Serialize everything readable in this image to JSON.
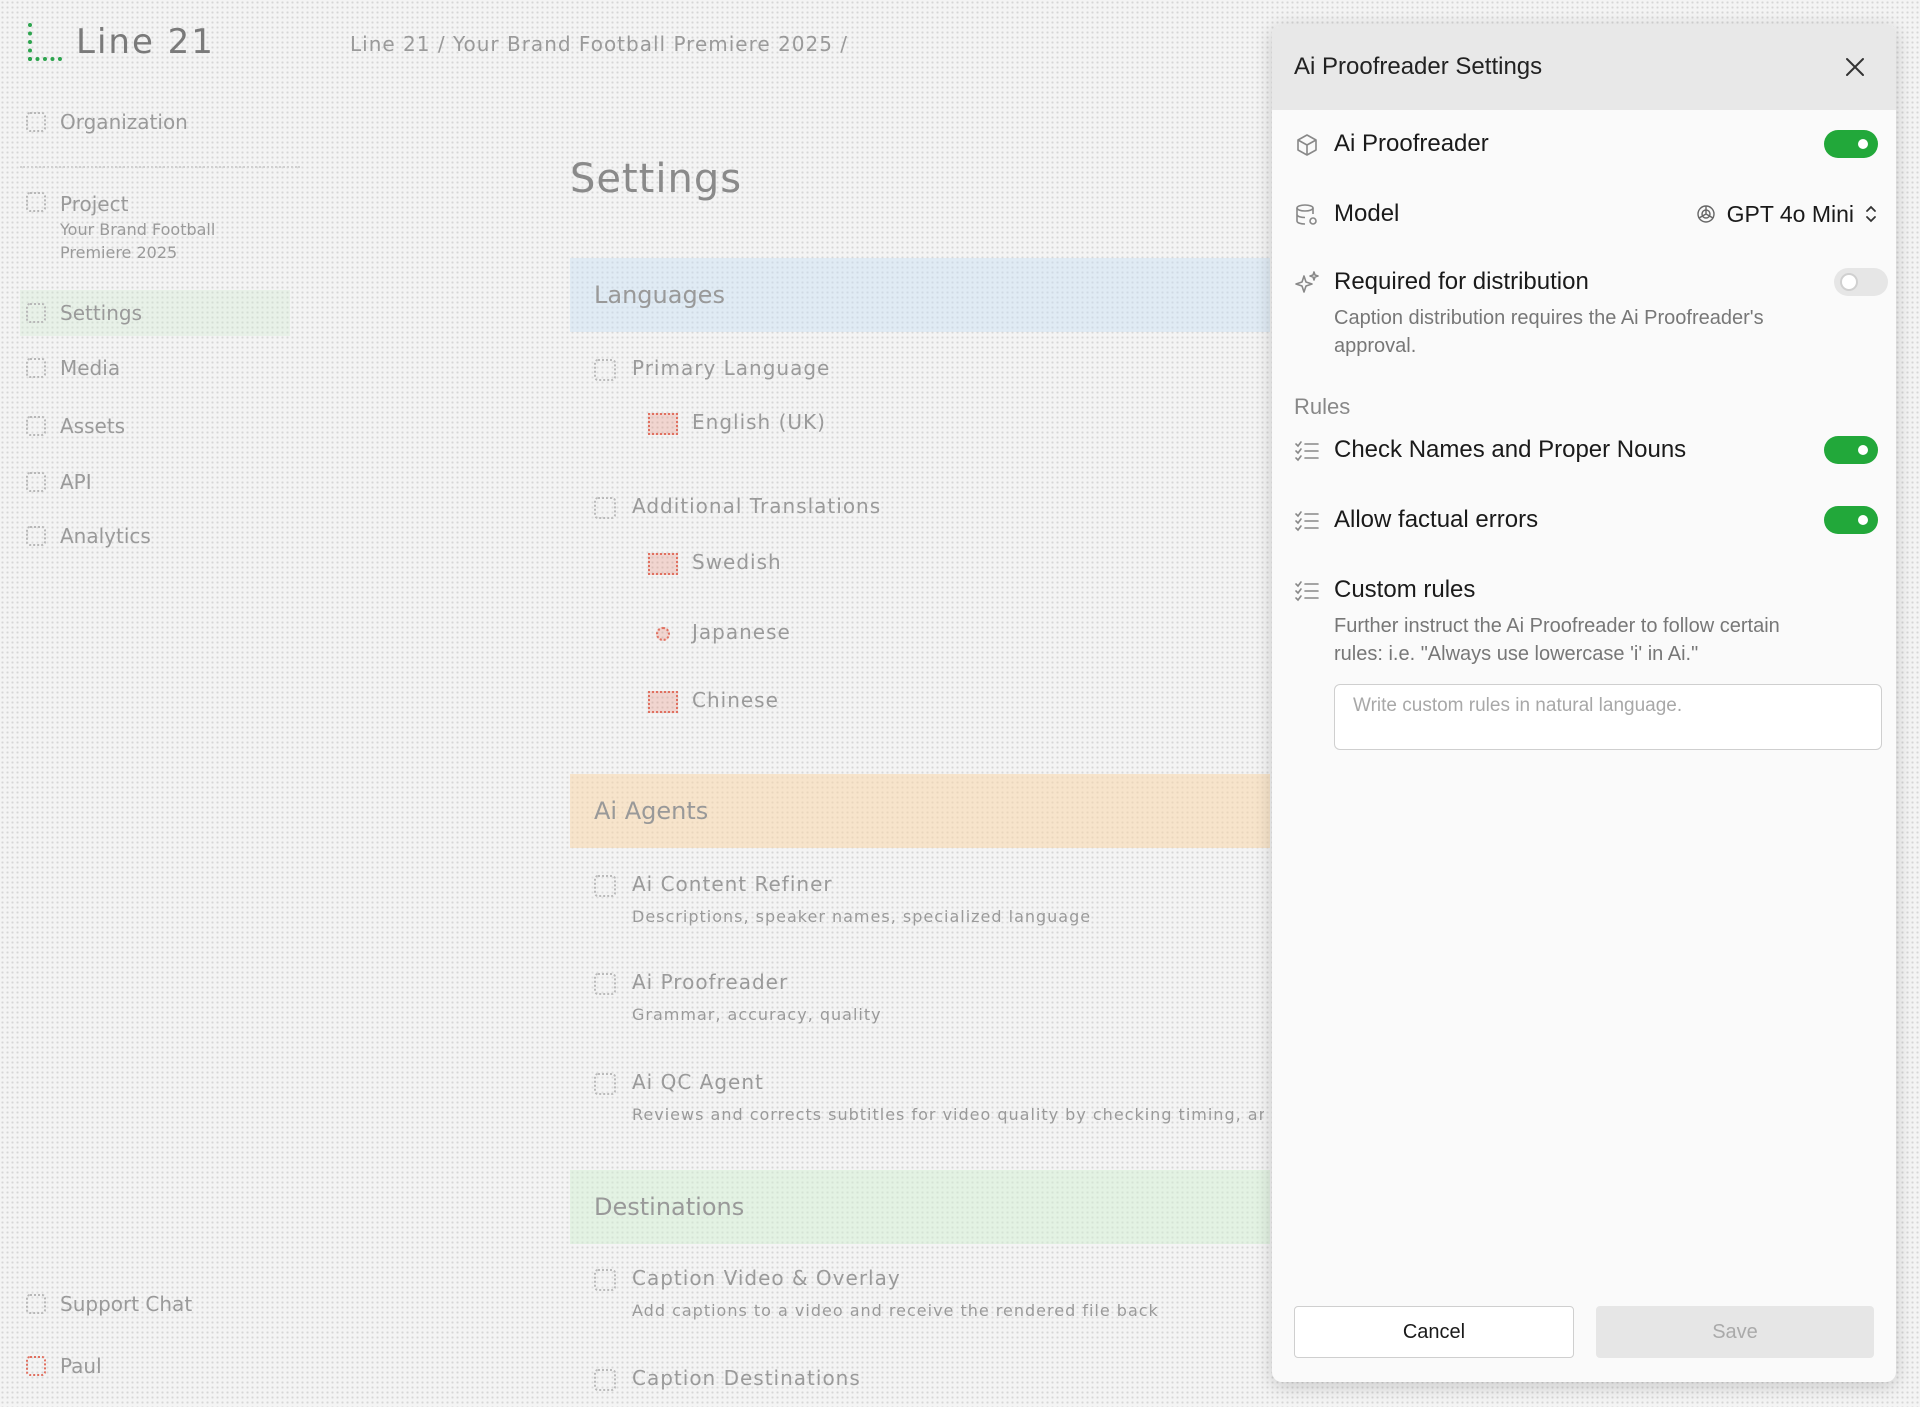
{
  "background": {
    "logo_text": "Line 21",
    "breadcrumb": "Line 21  /  Your Brand Football Premiere 2025  /",
    "sidebar": {
      "organization": "Organization",
      "project_label": "Project",
      "project_line1": "Your Brand Football",
      "project_line2": "Premiere 2025",
      "items": [
        {
          "label": "Settings"
        },
        {
          "label": "Media"
        },
        {
          "label": "Assets"
        },
        {
          "label": "API"
        },
        {
          "label": "Analytics"
        }
      ],
      "support": "Support Chat",
      "user": "Paul"
    },
    "page_title": "Settings",
    "sections": {
      "languages": "Languages",
      "primary_language": "Primary Language",
      "primary_value": "English (UK)",
      "additional_translations": "Additional Translations",
      "translations": [
        "Swedish",
        "Japanese",
        "Chinese"
      ],
      "ai_agents": "Ai Agents",
      "agents": [
        {
          "name": "Ai Content Refiner",
          "desc": "Descriptions, speaker names, specialized language"
        },
        {
          "name": "Ai Proofreader",
          "desc": "Grammar, accuracy, quality"
        },
        {
          "name": "Ai QC Agent",
          "desc": "Reviews and corrects subtitles for video quality by checking timing, and C..."
        }
      ],
      "destinations": "Destinations",
      "destination_items": [
        {
          "name": "Caption Video & Overlay",
          "desc": "Add captions to a video and receive the rendered file back"
        },
        {
          "name": "Caption Destinations",
          "desc": ""
        }
      ]
    }
  },
  "modal": {
    "title": "Ai Proofreader Settings",
    "proofreader": {
      "label": "Ai Proofreader",
      "enabled": true,
      "icon": "cube-icon"
    },
    "model": {
      "label": "Model",
      "value": "GPT 4o Mini",
      "icon": "database-gear-icon"
    },
    "required": {
      "label": "Required for distribution",
      "enabled": false,
      "description": "Caption distribution requires the Ai Proofreader's approval.",
      "icon": "sparkle-icon"
    },
    "rules_header": "Rules",
    "rules": [
      {
        "label": "Check Names and Proper Nouns",
        "enabled": true,
        "icon": "checklist-icon"
      },
      {
        "label": "Allow factual errors",
        "enabled": true,
        "icon": "checklist-icon"
      }
    ],
    "custom_rules": {
      "label": "Custom rules",
      "description": "Further instruct the Ai Proofreader to follow certain rules: i.e. \"Always use lowercase 'i' in Ai.\"",
      "placeholder": "Write custom rules in natural language.",
      "value": ""
    },
    "cancel_label": "Cancel",
    "save_label": "Save",
    "colors": {
      "toggle_on": "#22a83a",
      "toggle_off": "#e6e6e6"
    }
  }
}
